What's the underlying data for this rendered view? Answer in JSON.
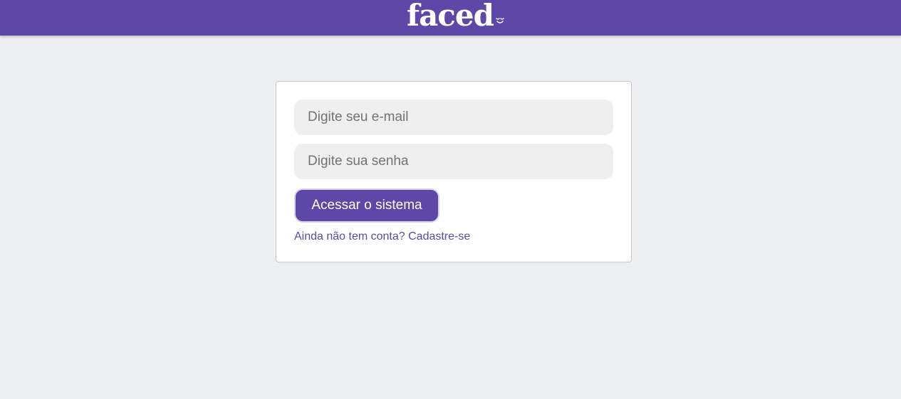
{
  "header": {
    "logo_text": "faced",
    "logo_icon": "smile-icon",
    "background_color": "#5d48a8"
  },
  "login_form": {
    "email_placeholder": "Digite seu e-mail",
    "password_placeholder": "Digite sua senha",
    "submit_label": "Acessar o sistema",
    "signup_link_label": "Ainda não tem conta? Cadastre-se"
  },
  "colors": {
    "accent": "#5d48a8",
    "page_background": "#ecedef",
    "input_background": "#efefef"
  }
}
